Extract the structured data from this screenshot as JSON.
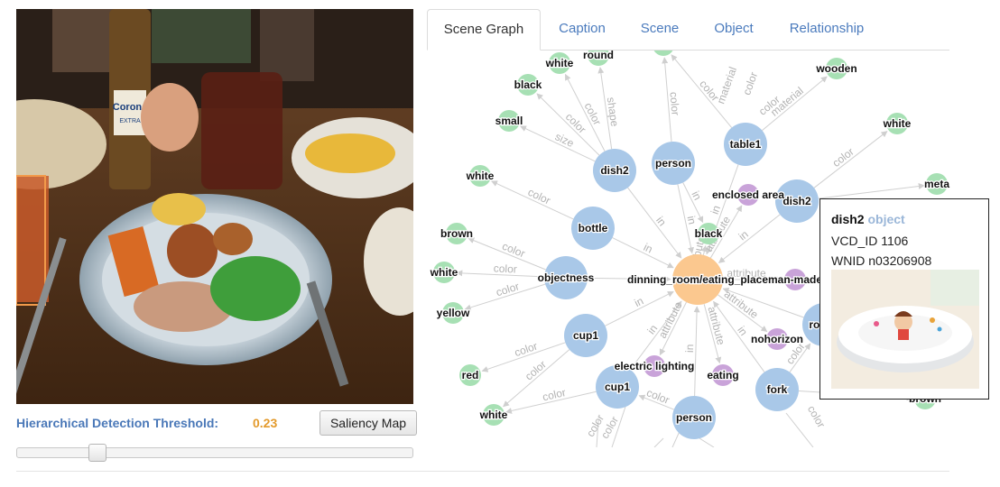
{
  "detection": {
    "threshold_label": "Hierarchical Detection Threshold:",
    "threshold_value": "0.23",
    "threshold_fraction": 0.19,
    "saliency_button": "Saliency Map"
  },
  "tabs": [
    {
      "label": "Scene Graph",
      "active": true
    },
    {
      "label": "Caption",
      "active": false
    },
    {
      "label": "Scene",
      "active": false
    },
    {
      "label": "Object",
      "active": false
    },
    {
      "label": "Relationship",
      "active": false
    }
  ],
  "photo": {
    "bottle_label": "Corona",
    "bottle_sub": "EXTRA"
  },
  "graph": {
    "colors": {
      "object": "#a9c8e8",
      "attribute": "#a7e0b4",
      "scene": "#c9a3d9",
      "center": "#fbc88f",
      "edge": "#d0d0d0"
    },
    "nodes": [
      {
        "id": "center",
        "label": "dinning_room/eating_place",
        "type": "center"
      },
      {
        "id": "dish2a",
        "label": "dish2",
        "type": "object"
      },
      {
        "id": "person1",
        "label": "person",
        "type": "object"
      },
      {
        "id": "table1",
        "label": "table1",
        "type": "object"
      },
      {
        "id": "dish2b",
        "label": "dish2",
        "type": "object"
      },
      {
        "id": "bottle",
        "label": "bottle",
        "type": "object"
      },
      {
        "id": "objectness",
        "label": "objectness",
        "type": "object"
      },
      {
        "id": "cup1a",
        "label": "cup1",
        "type": "object"
      },
      {
        "id": "cup1b",
        "label": "cup1",
        "type": "object"
      },
      {
        "id": "person2",
        "label": "person",
        "type": "object"
      },
      {
        "id": "fork",
        "label": "fork",
        "type": "object"
      },
      {
        "id": "rootv",
        "label": "root v",
        "type": "object"
      },
      {
        "id": "enclosed",
        "label": "enclosed area",
        "type": "scene"
      },
      {
        "id": "manmade",
        "label": "man-made",
        "type": "scene"
      },
      {
        "id": "nohorizon",
        "label": "nohorizon",
        "type": "scene"
      },
      {
        "id": "eating",
        "label": "eating",
        "type": "scene"
      },
      {
        "id": "elec",
        "label": "electric lighting",
        "type": "scene"
      },
      {
        "id": "white1",
        "label": "white",
        "type": "attribute"
      },
      {
        "id": "round",
        "label": "round",
        "type": "attribute"
      },
      {
        "id": "black1",
        "label": "black",
        "type": "attribute"
      },
      {
        "id": "small",
        "label": "small",
        "type": "attribute"
      },
      {
        "id": "white2",
        "label": "white",
        "type": "attribute"
      },
      {
        "id": "brown1",
        "label": "brown",
        "type": "attribute"
      },
      {
        "id": "white3",
        "label": "white",
        "type": "attribute"
      },
      {
        "id": "yellow",
        "label": "yellow",
        "type": "attribute"
      },
      {
        "id": "red",
        "label": "red",
        "type": "attribute"
      },
      {
        "id": "white4",
        "label": "white",
        "type": "attribute"
      },
      {
        "id": "wooden",
        "label": "wooden",
        "type": "attribute"
      },
      {
        "id": "white5",
        "label": "white",
        "type": "attribute"
      },
      {
        "id": "meta",
        "label": "meta",
        "type": "attribute"
      },
      {
        "id": "black2",
        "label": "black",
        "type": "attribute"
      },
      {
        "id": "brown2",
        "label": "brown",
        "type": "attribute"
      },
      {
        "id": "topg1",
        "label": "",
        "type": "attribute"
      }
    ],
    "edges": [
      {
        "from": "dish2a",
        "to": "center",
        "label": "in"
      },
      {
        "from": "person1",
        "to": "center",
        "label": "in"
      },
      {
        "from": "table1",
        "to": "center",
        "label": "in"
      },
      {
        "from": "dish2b",
        "to": "center",
        "label": "in"
      },
      {
        "from": "bottle",
        "to": "center",
        "label": "in"
      },
      {
        "from": "objectness",
        "to": "center",
        "label": ""
      },
      {
        "from": "cup1a",
        "to": "center",
        "label": "in"
      },
      {
        "from": "cup1b",
        "to": "center",
        "label": "in"
      },
      {
        "from": "person2",
        "to": "center",
        "label": "in"
      },
      {
        "from": "fork",
        "to": "center",
        "label": "in"
      },
      {
        "from": "rootv",
        "to": "center",
        "label": ""
      },
      {
        "from": "center",
        "to": "enclosed",
        "label": "attribute"
      },
      {
        "from": "center",
        "to": "manmade",
        "label": "attribute"
      },
      {
        "from": "center",
        "to": "nohorizon",
        "label": "attribute"
      },
      {
        "from": "center",
        "to": "eating",
        "label": "attribute"
      },
      {
        "from": "center",
        "to": "elec",
        "label": "attribute"
      },
      {
        "from": "center",
        "to": "black2",
        "label": "attribute"
      },
      {
        "from": "dish2a",
        "to": "white1",
        "label": "color"
      },
      {
        "from": "dish2a",
        "to": "round",
        "label": "shape"
      },
      {
        "from": "dish2a",
        "to": "black1",
        "label": "color"
      },
      {
        "from": "dish2a",
        "to": "small",
        "label": "size"
      },
      {
        "from": "bottle",
        "to": "white2",
        "label": "color"
      },
      {
        "from": "objectness",
        "to": "brown1",
        "label": "color"
      },
      {
        "from": "objectness",
        "to": "white3",
        "label": "color"
      },
      {
        "from": "objectness",
        "to": "yellow",
        "label": "color"
      },
      {
        "from": "cup1a",
        "to": "red",
        "label": "color"
      },
      {
        "from": "cup1a",
        "to": "white4",
        "label": "color"
      },
      {
        "from": "table1",
        "to": "wooden",
        "label": "material"
      },
      {
        "from": "table1",
        "to": "topg1",
        "label": "color"
      },
      {
        "from": "dish2b",
        "to": "white5",
        "label": "color"
      },
      {
        "from": "dish2b",
        "to": "meta",
        "label": ""
      },
      {
        "from": "person1",
        "to": "black2",
        "label": "in"
      },
      {
        "from": "person1",
        "to": "topg1",
        "label": "color"
      },
      {
        "from": "fork",
        "to": "brown2",
        "label": "material"
      },
      {
        "from": "fork",
        "to": "rootv",
        "label": "color"
      },
      {
        "from": "cup1b",
        "to": "white4",
        "label": "color"
      },
      {
        "from": "person2",
        "to": "cup1b",
        "label": "color"
      }
    ],
    "edge_extra_labels": [
      "material",
      "color",
      "color",
      "color",
      "color",
      "color"
    ]
  },
  "tooltip": {
    "name": "dish2",
    "type": "object",
    "vcd_line": "VCD_ID 1106",
    "wnid_line": "WNID n03206908"
  }
}
